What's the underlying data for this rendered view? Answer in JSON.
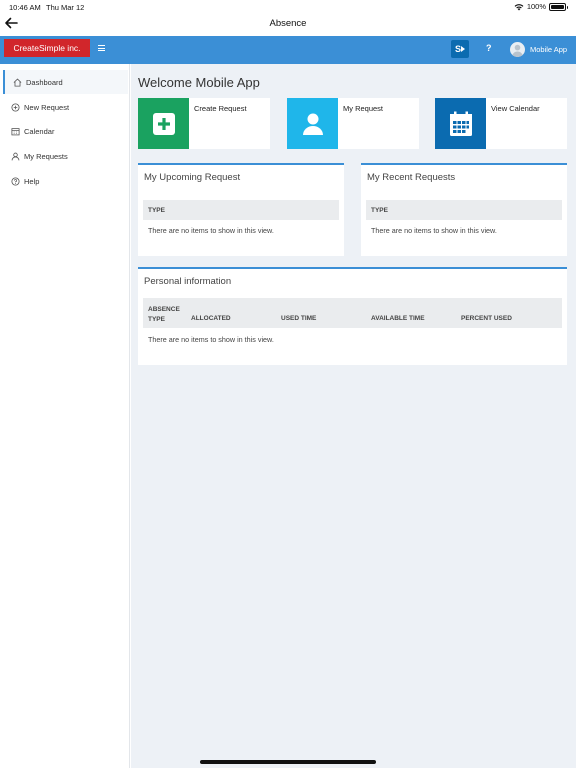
{
  "status_bar": {
    "time": "10:46 AM",
    "date": "Thu Mar 12",
    "battery": "100%",
    "battery_level": 1.0
  },
  "titlebar": {
    "title": "Absence"
  },
  "header": {
    "logo": "CreateSimple inc.",
    "help": "?",
    "user_name": "Mobile App",
    "sharepoint_label": "S"
  },
  "sidebar": {
    "items": [
      {
        "label": "Dashboard",
        "icon": "home-icon",
        "active": true
      },
      {
        "label": "New Request",
        "icon": "plus-circle-icon"
      },
      {
        "label": "Calendar",
        "icon": "calendar-icon"
      },
      {
        "label": "My Requests",
        "icon": "person-icon"
      },
      {
        "label": "Help",
        "icon": "help-circle-icon"
      }
    ]
  },
  "main": {
    "welcome": "Welcome Mobile App",
    "tiles": [
      {
        "label": "Create Request",
        "color": "#1aa260",
        "icon": "plus-icon"
      },
      {
        "label": "My Request",
        "color": "#1fb6ea",
        "icon": "person-icon"
      },
      {
        "label": "View Calendar",
        "color": "#0b6bb0",
        "icon": "calendar-icon"
      }
    ],
    "upcoming": {
      "title": "My Upcoming Request",
      "column": "TYPE",
      "empty": "There are no items to show in this view."
    },
    "recent": {
      "title": "My Recent Requests",
      "column": "TYPE",
      "empty": "There are no items to show in this view."
    },
    "personal": {
      "title": "Personal information",
      "columns": [
        "ABSENCE TYPE",
        "ALLOCATED",
        "USED TIME",
        "AVAILABLE TIME",
        "PERCENT USED"
      ],
      "col0_line1": "ABSENCE",
      "col0_line2": "TYPE",
      "empty": "There are no items to show in this view."
    }
  },
  "colors": {
    "accent": "#3b8fd6",
    "logo_bg": "#d1262b",
    "background": "#edf1f6"
  }
}
